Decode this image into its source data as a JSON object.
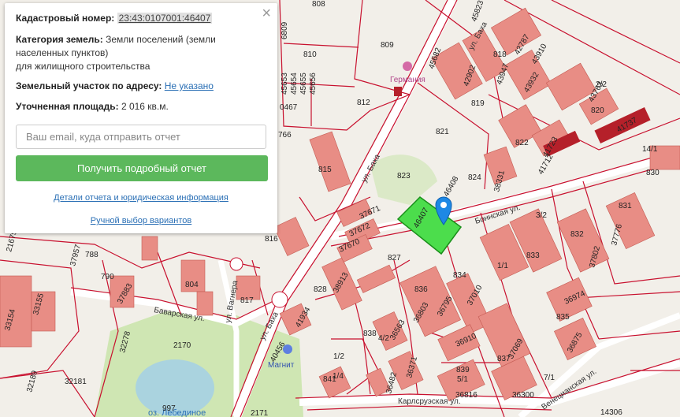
{
  "panel": {
    "close_icon": "×",
    "cadastral_label": "Кадастровый номер:",
    "cadastral_value": "23:43:0107001:46407",
    "category_label": "Категория земель:",
    "category_value_1": "Земли поселений (земли",
    "category_value_2": "населенных пунктов)",
    "category_value_3": "для жилищного строительства",
    "address_label": "Земельный участок по адресу:",
    "address_value": "Не указано",
    "area_label": "Уточненная площадь:",
    "area_value": "2 016 кв.м.",
    "email_placeholder": "Ваш email, куда отправить отчет",
    "report_button": "Получить подробный отчет",
    "details_link": "Детали отчета и юридическая информация",
    "manual_link": "Ручной выбор вариантов"
  },
  "map": {
    "selected_parcel": "46407",
    "poi_germania": "Германия",
    "poi_magnit": "Магнит",
    "lake": "оз. Лебединое",
    "streets": {
      "baha": "ул. Баха",
      "baha_top": "ул. Баха",
      "baha_bottom": "ул. Баха",
      "bonnskaya": "Боннская ул.",
      "bavarskaya": "Баварская ул.",
      "vagnera": "ул. Вагнера",
      "karlsruhskaya": "Карлсруэская ул.",
      "veneciyskaya": "Венецианская ул."
    },
    "parcels": [
      "808",
      "809",
      "810",
      "812",
      "821",
      "823",
      "824",
      "815",
      "816",
      "788",
      "790",
      "804",
      "817",
      "828",
      "827",
      "836",
      "834",
      "833",
      "832",
      "831",
      "830",
      "822",
      "818",
      "819",
      "820",
      "835",
      "837",
      "838",
      "839",
      "841",
      "14306",
      "2170",
      "2171",
      "997",
      "32181",
      "32189",
      "32278",
      "33155",
      "33154",
      "37957",
      "37883",
      "41934",
      "40456",
      "37671",
      "37672",
      "37670",
      "38913",
      "36803",
      "36795",
      "37010",
      "36910",
      "37069",
      "36974",
      "36875",
      "36816",
      "36300",
      "36371",
      "36482",
      "36563",
      "38331",
      "41712",
      "41723",
      "41737",
      "43763",
      "43910",
      "43932",
      "43947",
      "42902",
      "42787",
      "45823",
      "45682",
      "45653",
      "45654",
      "45656",
      "45655",
      "46408",
      "37802",
      "37776",
      "0467",
      "1/1",
      "1/2",
      "4/2",
      "7/1",
      "3/2",
      "5/1",
      "2/2",
      "14/1",
      "1/4",
      "21675",
      "6809",
      "766"
    ]
  }
}
